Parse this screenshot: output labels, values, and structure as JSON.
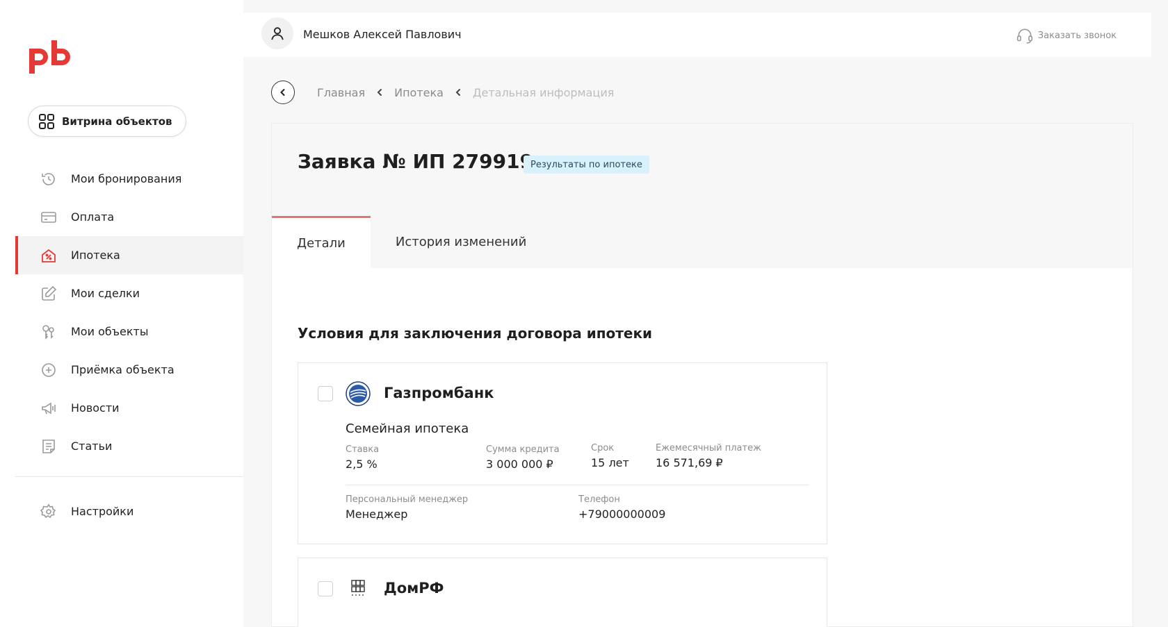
{
  "user": {
    "name": "Мешков Алексей Павлович"
  },
  "header": {
    "callback_label": "Заказать звонок"
  },
  "sidebar": {
    "showcase_label": "Витрина объектов",
    "items": [
      {
        "label": "Мои бронирования",
        "icon": "history-icon"
      },
      {
        "label": "Оплата",
        "icon": "card-icon"
      },
      {
        "label": "Ипотека",
        "icon": "house-percent-icon",
        "active": true
      },
      {
        "label": "Мои сделки",
        "icon": "edit-icon"
      },
      {
        "label": "Мои объекты",
        "icon": "keys-icon"
      },
      {
        "label": "Приёмка объекта",
        "icon": "plus-circle-icon"
      },
      {
        "label": "Новости",
        "icon": "megaphone-icon"
      },
      {
        "label": "Статьи",
        "icon": "article-icon"
      }
    ],
    "settings_label": "Настройки"
  },
  "breadcrumb": {
    "items": [
      "Главная",
      "Ипотека",
      "Детальная информация"
    ]
  },
  "application": {
    "title": "Заявка № ИП 279919",
    "status": "Результаты по ипотеке",
    "tabs": [
      "Детали",
      "История изменений"
    ]
  },
  "section_title": "Условия для заключения договора ипотеки",
  "offers": [
    {
      "bank": "Газпромбанк",
      "program": "Семейная ипотека",
      "rate_label": "Ставка",
      "rate": "2,5 %",
      "amount_label": "Сумма кредита",
      "amount": "3 000 000 ₽",
      "term_label": "Срок",
      "term": "15 лет",
      "payment_label": "Ежемесячный платеж",
      "payment": "16 571,69 ₽",
      "manager_label": "Персональный менеджер",
      "manager": "Менеджер",
      "phone_label": "Телефон",
      "phone": "+79000000009"
    },
    {
      "bank": "ДомРФ"
    }
  ],
  "colors": {
    "accent": "#e53935",
    "badge_bg": "#d9f1fb",
    "page_bg": "#f7f7f7"
  }
}
